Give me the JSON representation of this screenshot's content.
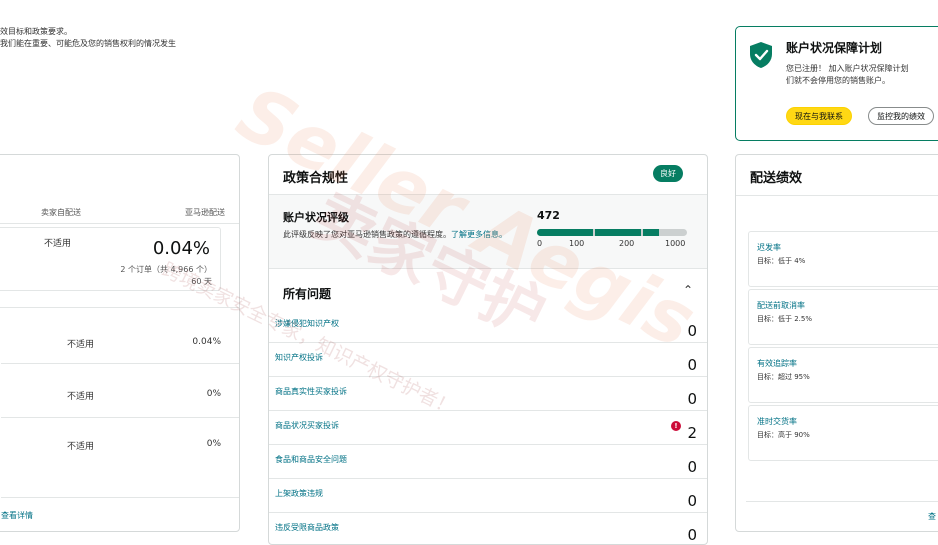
{
  "intro": {
    "line1": "效目标和政策要求。",
    "line2": "我们能在重要、可能危及您的销售权利的情况发生"
  },
  "left_card": {
    "columns": [
      "卖家自配送",
      "亚马逊配送"
    ],
    "top_row": {
      "seller_value": "不适用",
      "amazon_value": "0.04%",
      "orders_text": "2 个订单（共 4,966 个）",
      "period": "60 天"
    },
    "rows": [
      {
        "seller_value": "不适用",
        "amazon_value": "0.04%"
      },
      {
        "seller_value": "不适用",
        "amazon_value": "0%"
      },
      {
        "seller_value": "不适用",
        "amazon_value": "0%"
      }
    ],
    "view_details": "查看详情"
  },
  "policy_card": {
    "title": "政策合规性",
    "status_badge": "良好",
    "ahr": {
      "title": "账户状况评级",
      "description": "此评级反映了您对亚马逊销售政策的遵循程度。",
      "learn_more": "了解更多信息。",
      "score": "472",
      "score_value": 472,
      "scale_ticks": [
        "0",
        "100",
        "200",
        "1000"
      ]
    },
    "issues_title": "所有问题",
    "issues": [
      {
        "label": "涉嫌侵犯知识产权",
        "count": "0",
        "alert": false
      },
      {
        "label": "知识产权投诉",
        "count": "0",
        "alert": false
      },
      {
        "label": "商品真实性买家投诉",
        "count": "0",
        "alert": false
      },
      {
        "label": "商品状况买家投诉",
        "count": "2",
        "alert": true
      },
      {
        "label": "食品和商品安全问题",
        "count": "0",
        "alert": false
      },
      {
        "label": "上架政策违规",
        "count": "0",
        "alert": false
      },
      {
        "label": "违反受限商品政策",
        "count": "0",
        "alert": false
      }
    ]
  },
  "ahp_card": {
    "title": "账户状况保障计划",
    "desc_line1": "您已注册！ 加入账户状况保障计划",
    "desc_line2": "们就不会停用您的销售账户。",
    "contact_button": "现在与我联系",
    "monitor_button": "监控我的绩效"
  },
  "shipping_card": {
    "title": "配送绩效",
    "metrics": [
      {
        "name": "迟发率",
        "target": "目标：低于 4%"
      },
      {
        "name": "配送前取消率",
        "target": "目标：低于 2.5%"
      },
      {
        "name": "有效追踪率",
        "target": "目标：超过 95%"
      },
      {
        "name": "准时交货率",
        "target": "目标：高于 90%"
      }
    ],
    "footer_link": "查"
  },
  "watermark": {
    "brand_latin": "Seller Aegis",
    "brand_cn": "卖家守护",
    "slogan": "跨境卖家安全专家，知识产权守护者！"
  },
  "colors": {
    "good_green": "#067d62",
    "link_teal": "#007185",
    "alert_red": "#cc0c39",
    "button_yellow": "#ffd814"
  }
}
